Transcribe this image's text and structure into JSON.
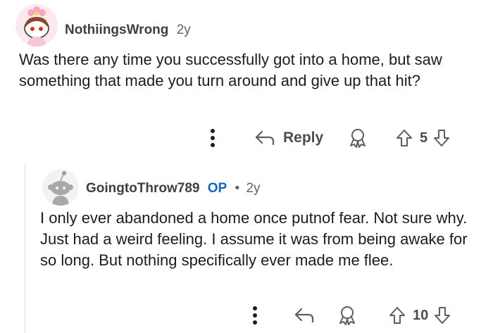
{
  "colors": {
    "text": "#1c1c1c",
    "meta": "#5f6368",
    "op_badge": "#1565c0",
    "icon": "#5b5e63"
  },
  "comment": {
    "username": "NothiingsWrong",
    "age": "2y",
    "body": "Was there any time you successfully got into a home, but saw something that made you turn around and give up that hit?",
    "actions": {
      "more_icon": "more-options-icon",
      "reply_label": "Reply",
      "award_icon": "award-icon",
      "vote_count": "5"
    }
  },
  "reply": {
    "username": "GoingtoThrow789",
    "op_label": "OP",
    "separator": "•",
    "age": "2y",
    "body": "I only ever abandoned a home once putnof fear. Not sure why. Just had a weird feeling. I assume it was from being awake for so long. But nothing specifically ever made me flee.",
    "actions": {
      "more_icon": "more-options-icon",
      "award_icon": "award-icon",
      "vote_count": "10"
    }
  }
}
